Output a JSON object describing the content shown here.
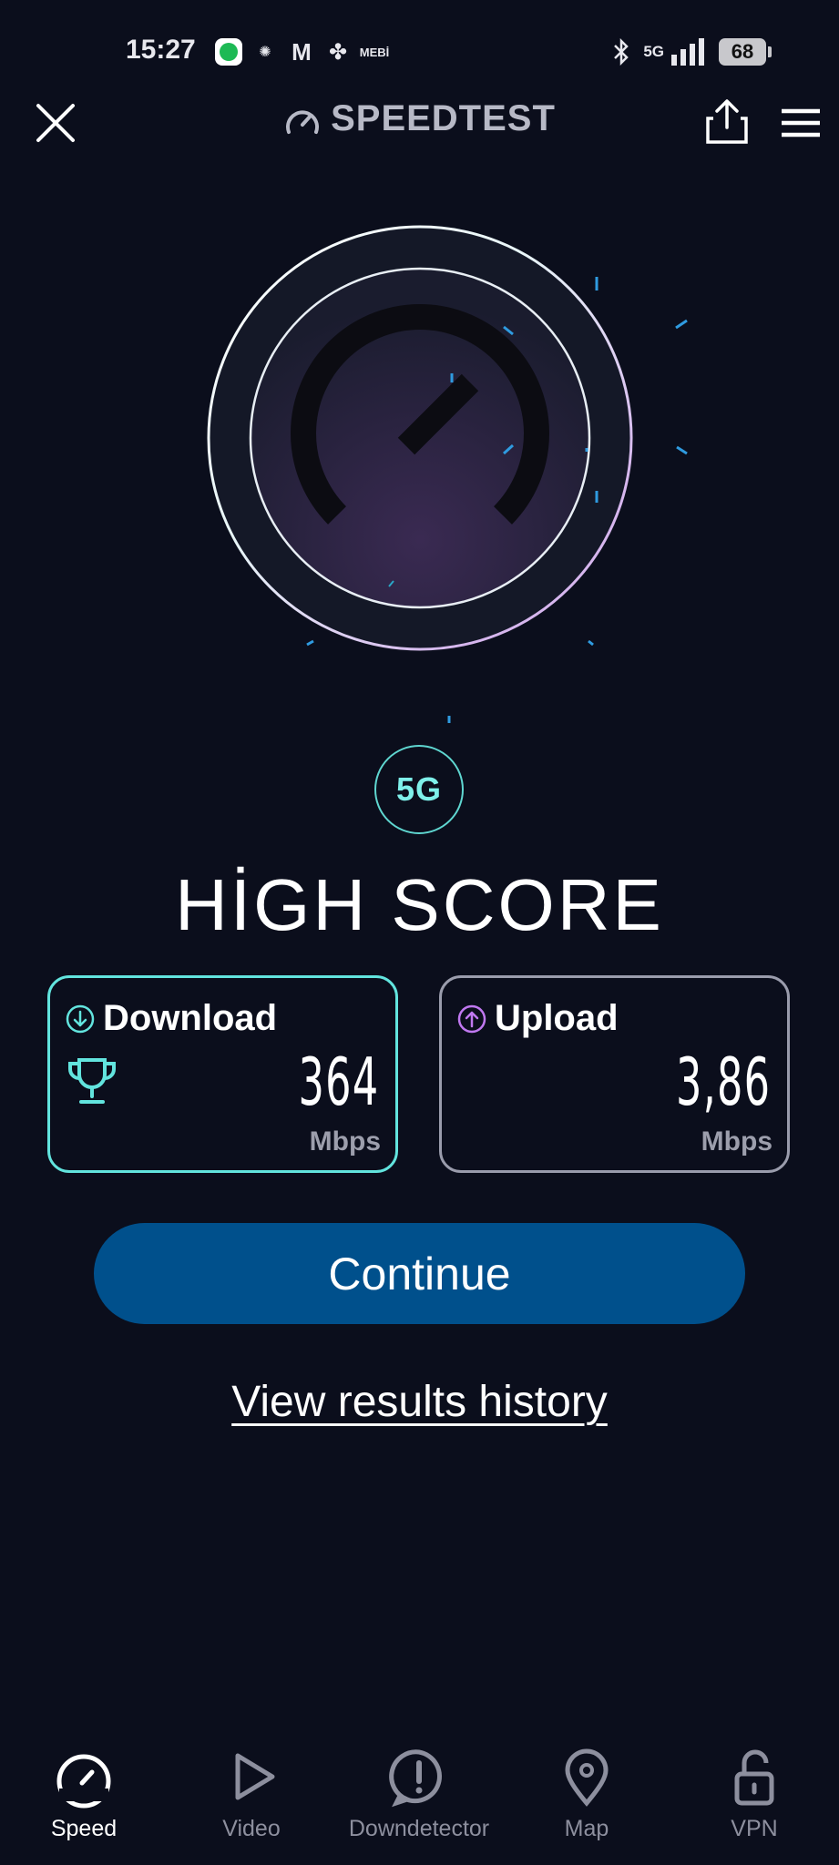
{
  "status_bar": {
    "time": "15:27",
    "notification_icons": [
      "spotify-icon",
      "app-icon",
      "gmail-icon",
      "app-icon",
      "mebi-icon"
    ],
    "mebi_text": "MEBİ",
    "network": "5G",
    "battery": "68"
  },
  "header": {
    "title": "SPEEDTEST",
    "icons": [
      "close-icon",
      "speedtest-logo-icon",
      "share-icon",
      "menu-icon"
    ]
  },
  "gauge": {
    "connection_type": "5G"
  },
  "result": {
    "headline": "HİGH SCORE"
  },
  "download": {
    "label": "Download",
    "value": "364",
    "unit": "Mbps",
    "accent": "#62e4de"
  },
  "upload": {
    "label": "Upload",
    "value": "3,86",
    "unit": "Mbps",
    "accent": "#c078f0"
  },
  "actions": {
    "continue_label": "Continue",
    "history_label": "View results history"
  },
  "nav": {
    "items": [
      {
        "label": "Speed",
        "icon": "speed-icon"
      },
      {
        "label": "Video",
        "icon": "play-icon"
      },
      {
        "label": "Downdetector",
        "icon": "alert-icon"
      },
      {
        "label": "Map",
        "icon": "map-pin-icon"
      },
      {
        "label": "VPN",
        "icon": "lock-icon"
      }
    ]
  }
}
